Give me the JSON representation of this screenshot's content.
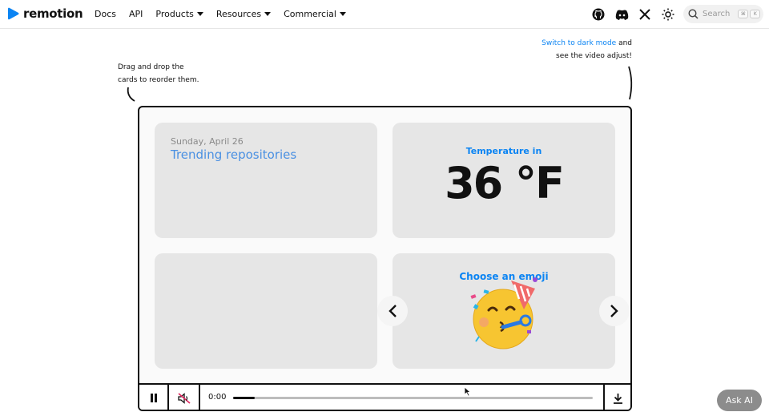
{
  "brand": {
    "name": "remotion",
    "accent": "#0b84f3"
  },
  "nav": {
    "items": [
      {
        "label": "Docs",
        "dropdown": false
      },
      {
        "label": "API",
        "dropdown": false
      },
      {
        "label": "Products",
        "dropdown": true
      },
      {
        "label": "Resources",
        "dropdown": true
      },
      {
        "label": "Commercial",
        "dropdown": true
      }
    ],
    "icons": [
      "github-icon",
      "discord-icon",
      "x-icon",
      "theme-toggle-icon"
    ],
    "search": {
      "placeholder": "Search",
      "shortcut_keys": [
        "⌘",
        "K"
      ]
    }
  },
  "hints": {
    "left_line1": "Drag and drop the",
    "left_line2": "cards to reorder them.",
    "right_link": "Switch to dark mode",
    "right_after_link": " and",
    "right_line2": "see the video adjust!"
  },
  "cards": {
    "trending": {
      "date": "Sunday, April 26",
      "title": "Trending repositories"
    },
    "temperature": {
      "label": "Temperature in",
      "value": "36 °F"
    },
    "emoji": {
      "label": "Choose an emoji",
      "emoji_name": "partying-face"
    }
  },
  "player": {
    "time": "0:00",
    "progress_fraction": 0.06,
    "state": "playing",
    "muted": true
  },
  "ask_ai": {
    "label": "Ask AI"
  }
}
